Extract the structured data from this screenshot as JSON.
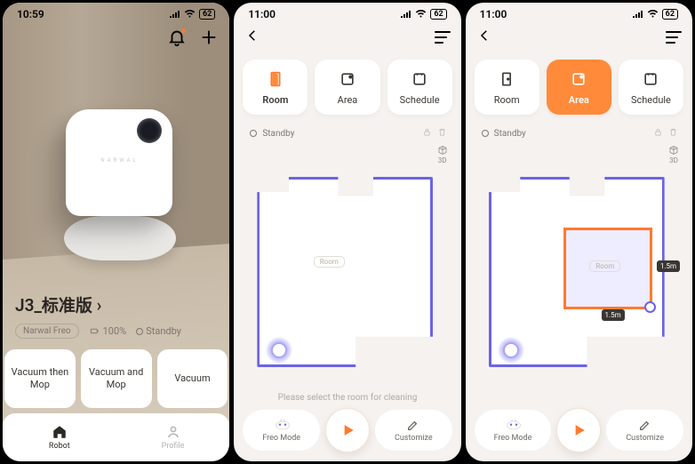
{
  "status": {
    "time1": "10:59",
    "time2": "11:00",
    "time3": "11:00",
    "battery": "62"
  },
  "home": {
    "device_brand": "NARWAL",
    "title": "J3_标准版 ›",
    "pill": "Narwal Freo",
    "battery_pct": "100%",
    "standby": "Standby",
    "modes": [
      "Vacuum then Mop",
      "Vacuum and Mop",
      "Vacuum"
    ],
    "tabs": {
      "robot": "Robot",
      "profile": "Profile"
    }
  },
  "map": {
    "segments": {
      "room": "Room",
      "area": "Area",
      "schedule": "Schedule"
    },
    "status_label": "Standby",
    "threeD": "3D",
    "room_label": "Room",
    "area_dim": "1.5m",
    "hint": "Please select the room for cleaning",
    "freo": "Freo Mode",
    "customize": "Customize"
  }
}
